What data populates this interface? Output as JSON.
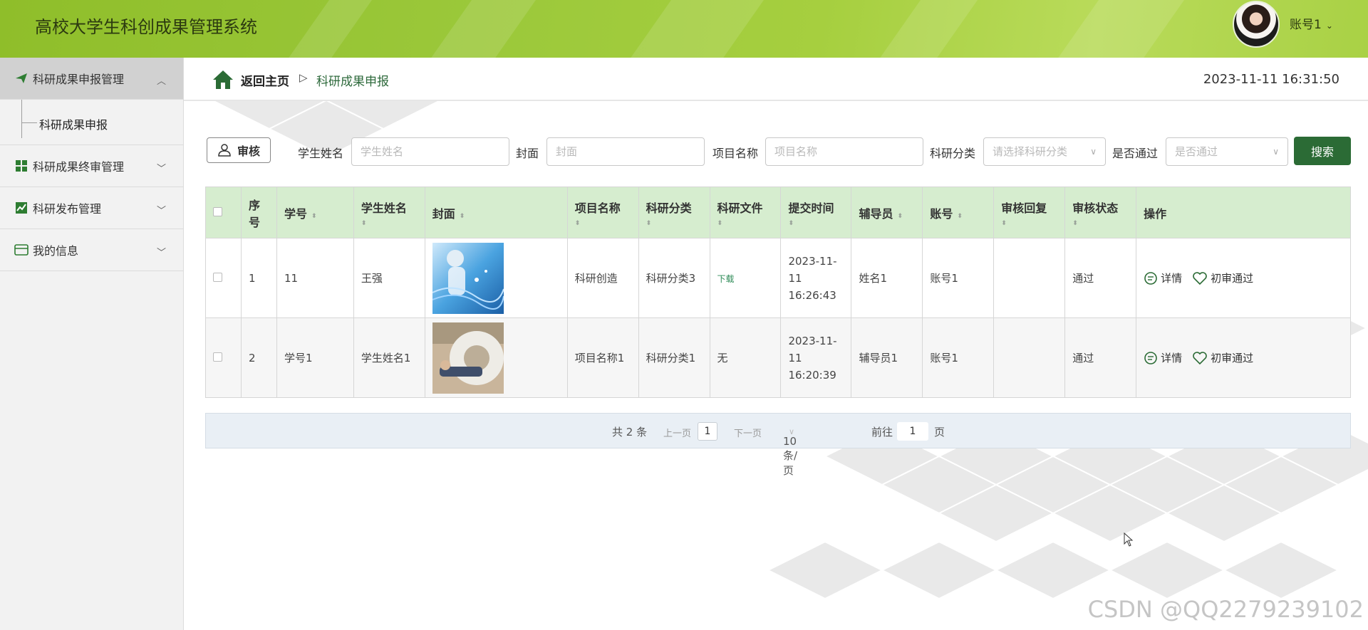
{
  "app": {
    "title": "高校大学生科创成果管理系统",
    "account": "账号1"
  },
  "sidebar": {
    "items": [
      {
        "label": "科研成果申报管理",
        "icon": "send-icon",
        "expanded": true
      },
      {
        "label": "科研成果终审管理",
        "icon": "grid-icon"
      },
      {
        "label": "科研发布管理",
        "icon": "chart-icon"
      },
      {
        "label": "我的信息",
        "icon": "card-icon"
      }
    ],
    "sub": {
      "label": "科研成果申报"
    }
  },
  "breadcrumb": {
    "home": "返回主页",
    "separator": "▷",
    "current": "科研成果申报",
    "time": "2023-11-11 16:31:50"
  },
  "search": {
    "audit_label": "审核",
    "student_name_label": "学生姓名",
    "student_name_placeholder": "学生姓名",
    "cover_label": "封面",
    "cover_placeholder": "封面",
    "project_label": "项目名称",
    "project_placeholder": "项目名称",
    "category_label": "科研分类",
    "category_placeholder": "请选择科研分类",
    "passed_label": "是否通过",
    "passed_placeholder": "是否通过",
    "search_button": "搜索"
  },
  "table": {
    "headers": {
      "idx": "序号",
      "student_no": "学号",
      "student_name": "学生姓名",
      "cover": "封面",
      "project": "项目名称",
      "category": "科研分类",
      "file": "科研文件",
      "submit_time": "提交时间",
      "counselor": "辅导员",
      "account": "账号",
      "reply": "审核回复",
      "status": "审核状态",
      "ops": "操作"
    },
    "rows": [
      {
        "idx": "1",
        "student_no": "11",
        "student_name": "王强",
        "project": "科研创造",
        "category": "科研分类3",
        "file": "下载",
        "submit_time": "2023-11-11 16:26:43",
        "counselor": "姓名1",
        "account": "账号1",
        "reply": "",
        "status": "通过",
        "detail": "详情",
        "first_pass": "初审通过"
      },
      {
        "idx": "2",
        "student_no": "学号1",
        "student_name": "学生姓名1",
        "project": "项目名称1",
        "category": "科研分类1",
        "file": "无",
        "submit_time": "2023-11-11 16:20:39",
        "counselor": "辅导员1",
        "account": "账号1",
        "reply": "",
        "status": "通过",
        "detail": "详情",
        "first_pass": "初审通过"
      }
    ]
  },
  "pager": {
    "total": "共 2 条",
    "prev": "上一页",
    "page": "1",
    "next": "下一页",
    "size": "10条/页",
    "goto": "前往",
    "goto_page": "1",
    "page_unit": "页"
  },
  "watermark": "CSDN @QQ2279239102",
  "colors": {
    "accent": "#2b6b35",
    "header": "#9bc83a",
    "table_header": "#d6edcf"
  }
}
